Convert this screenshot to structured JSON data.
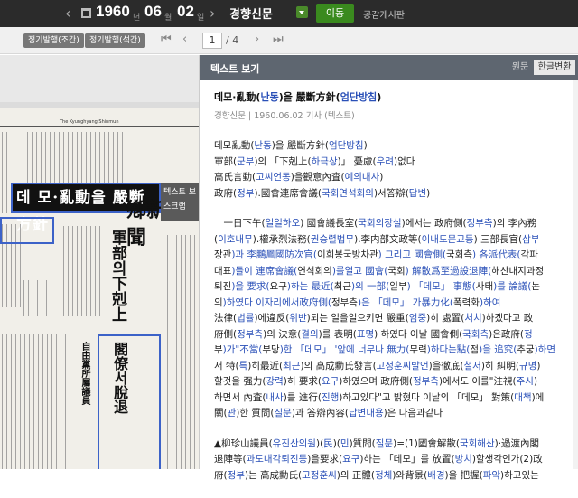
{
  "topbar": {
    "prev": "‹",
    "next": "›",
    "year": "1960",
    "year_unit": "년",
    "month": "06",
    "month_unit": "월",
    "day": "02",
    "day_unit": "일",
    "newspaper": "경향신문",
    "go_label": "이동",
    "board_label": "공감게시판"
  },
  "toolbar": {
    "tab1": "정기발행(조간)",
    "tab2": "정기발행(석간)",
    "first": "⏮",
    "prev": "‹",
    "page": "1",
    "total": "/ 4",
    "next": "›",
    "last": "⏭"
  },
  "viewer": {
    "popup_top": "텍스트 보",
    "popup_bottom": "스크랩",
    "masthead": "鄕新聞",
    "headline": "데 모·亂動을 嚴斷方針",
    "headline_sub": "交 涉",
    "col_a": "軍部의下剋上",
    "col_b": "閣僚서脫退",
    "col_c": "自由黨所屬議員"
  },
  "panel": {
    "title": "텍스트 보기",
    "btn_original": "원문",
    "btn_convert": "한글변환"
  },
  "article": {
    "headline_pre": "데모·亂動(",
    "headline_b1": "난동",
    "headline_mid": ")을 嚴斷方針(",
    "headline_b2": "엄단방침",
    "headline_post": ")",
    "meta": "경향신문 | 1960.06.02 기사 (텍스트)",
    "lead": [
      [
        "데모亂動(",
        "난동",
        ")을 嚴斷方針(",
        "엄단방침",
        ")"
      ],
      [
        "軍部(",
        "군부",
        ")의 「下剋上(",
        "하극상",
        ")」 憂慮(",
        "우려",
        ")없다"
      ],
      [
        "高氏言動(",
        "고씨언동",
        ")을觀意內査(",
        "예의내사",
        ")"
      ],
      [
        "政府(",
        "정부",
        ").國會連席會議(",
        "국회연석회의",
        ")서答辯(",
        "답변",
        ")"
      ]
    ],
    "body1": [
      [
        "　一日下午(",
        "일일하오",
        ") 國會議長室(",
        "국회의장실",
        ")에서는 政府側(",
        "정부측",
        ")의 李內務"
      ],
      [
        "(",
        "이호내무",
        ").權承烈法務(",
        "권승렬법무",
        ").李内部文政等(",
        "이내도문교등",
        ") 三部長官(",
        "삼부"
      ],
      [
        "장관",
        ")과 李鵬鳳國防次官(",
        "이희봉국방차관",
        ") 그리고 國會側(",
        "국회측",
        ") 各派代表(",
        "각파"
      ],
      [
        "대표",
        ")들이 連席會議(",
        "연석회의",
        ")를열고 國會(",
        "국회",
        ") 解散爲至過設退陣(",
        "해산내지과정"
      ],
      [
        "퇴진",
        ")을 要求(",
        "요구",
        ")하는 最近(",
        "최근",
        ")의 一部(",
        "일부",
        ") 「데모」 事態(",
        "사태",
        ")를 論議(",
        "논"
      ],
      [
        "의",
        ")하였다 이자리에서政府側(",
        "정부측",
        ")은 「데모」 가暴力化(",
        "폭력화",
        ")하여"
      ],
      [
        "法律(",
        "법률",
        ")에違反(",
        "위반",
        ")되는 일을일으키면 嚴重(",
        "엄중",
        ")히 處置(",
        "처치",
        ")하겠다고 政"
      ],
      [
        "府側(",
        "정부측",
        ")의 決意(",
        "결의",
        ")를 表明(",
        "표명",
        ") 하였다 이날 國會側(",
        "국회측",
        ")은政府(",
        "정"
      ],
      [
        "부",
        ")가\"不當(",
        "부당",
        ")한 「데모」 '앞에 너무나 無力(",
        "무력",
        ")하다는點(",
        "점",
        ")을 追究(",
        "추궁",
        ")하면"
      ],
      [
        "서 特(",
        "특",
        ")히最近(",
        "최근",
        ")의 高成勳氏發言(",
        "고정훈씨발언",
        ")을徹底(",
        "철저",
        ")히 糾明(",
        "규명",
        ")"
      ],
      [
        "할것을 强力(",
        "강력",
        ")히 要求(",
        "요구",
        ")하였으며 政府側(",
        "정부측",
        ")에서도 이를\"注視(",
        "주시",
        ")"
      ],
      [
        "하면서 內査(",
        "내사",
        ")를 進行(",
        "진행",
        ")하고있다\"고 밝혔다 이날의 「데모」 對策(",
        "대책",
        ")에"
      ],
      [
        "關(",
        "관",
        ")한 質問(",
        "질문",
        ")과 答辯內容(",
        "답변내용",
        ")은 다음과같다"
      ]
    ],
    "body2": [
      [
        "▲柳珍山議員(",
        "유진산의원",
        ")(",
        "民",
        ")(",
        "민",
        ")質問(",
        "질문",
        ")=(1)國會解散(",
        "국회해산",
        ")·過渡內閣"
      ],
      [
        "退陣等(",
        "과도내각퇴진등",
        ")을要求(",
        "요구",
        ")하는 「데모」를 放置(",
        "방치",
        ")할생각인가(2)政"
      ],
      [
        "府(",
        "정부",
        ")는 高成勳氏(",
        "고정훈씨",
        ")의 正體(",
        "정체",
        ")와背景(",
        "배경",
        ")을 把握(",
        "파악",
        ")하고있는"
      ]
    ]
  }
}
